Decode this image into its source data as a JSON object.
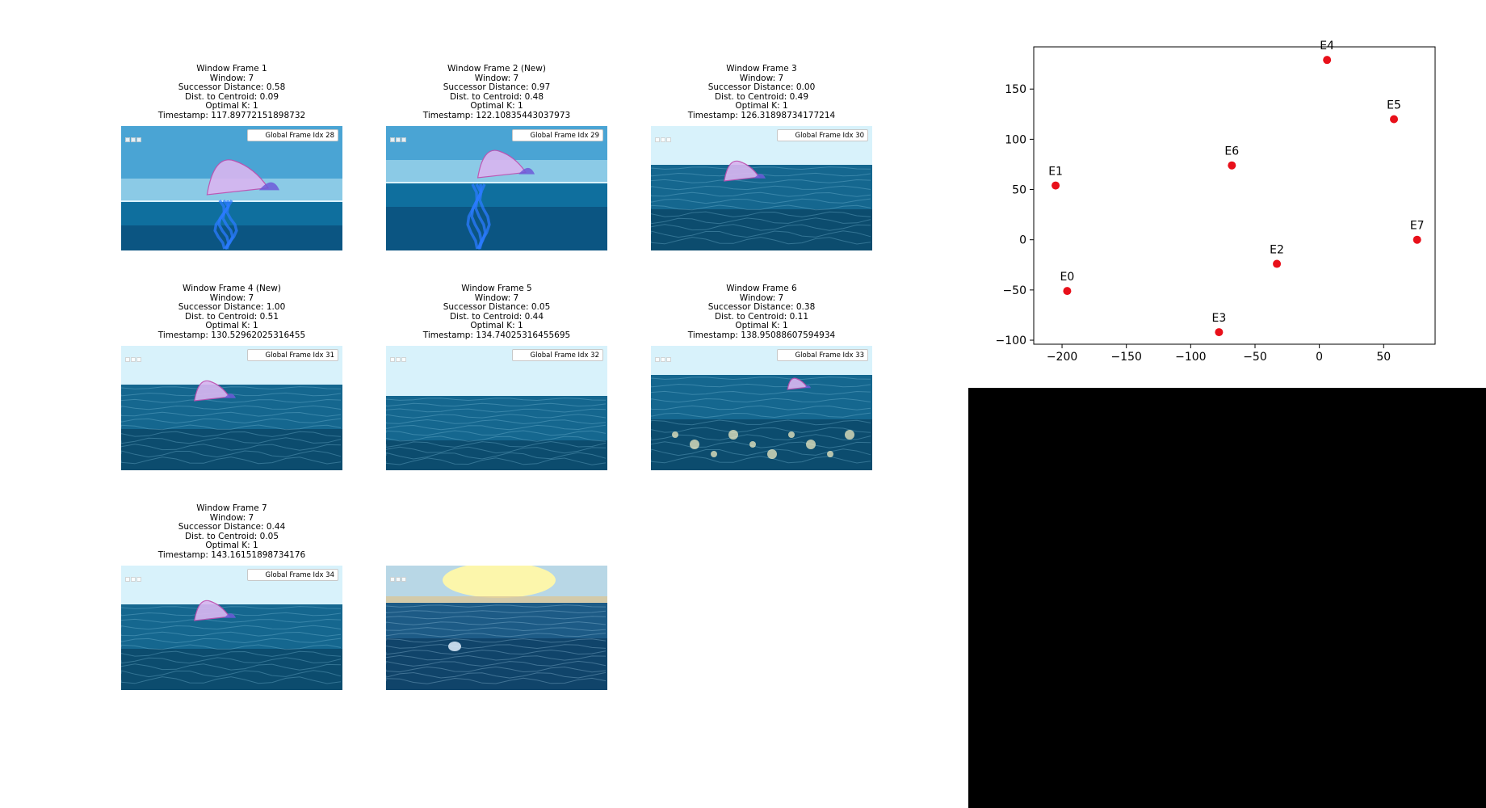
{
  "frames": [
    {
      "title": "Window Frame 1",
      "window": "Window: 7",
      "successor": "Successor Distance: 0.58",
      "centroid": "Dist. to Centroid: 0.09",
      "optimal_k": "Optimal K: 1",
      "timestamp": "Timestamp: 117.89772151898732",
      "idx_label": "Global Frame Idx 28",
      "scene": "jelly-large"
    },
    {
      "title": "Window Frame 2 (New)",
      "window": "Window: 7",
      "successor": "Successor Distance: 0.97",
      "centroid": "Dist. to Centroid: 0.48",
      "optimal_k": "Optimal K: 1",
      "timestamp": "Timestamp: 122.10835443037973",
      "idx_label": "Global Frame Idx 29",
      "scene": "jelly-split"
    },
    {
      "title": "Window Frame 3",
      "window": "Window: 7",
      "successor": "Successor Distance: 0.00",
      "centroid": "Dist. to Centroid: 0.49",
      "optimal_k": "Optimal K: 1",
      "timestamp": "Timestamp: 126.31898734177214",
      "idx_label": "Global Frame Idx 30",
      "scene": "waves-jelly"
    },
    {
      "title": "Window Frame 4 (New)",
      "window": "Window: 7",
      "successor": "Successor Distance: 1.00",
      "centroid": "Dist. to Centroid: 0.51",
      "optimal_k": "Optimal K: 1",
      "timestamp": "Timestamp: 130.52962025316455",
      "idx_label": "Global Frame Idx 31",
      "scene": "waves-jelly"
    },
    {
      "title": "Window Frame 5",
      "window": "Window: 7",
      "successor": "Successor Distance: 0.05",
      "centroid": "Dist. to Centroid: 0.44",
      "optimal_k": "Optimal K: 1",
      "timestamp": "Timestamp: 134.74025316455695",
      "idx_label": "Global Frame Idx 32",
      "scene": "waves"
    },
    {
      "title": "Window Frame 6",
      "window": "Window: 7",
      "successor": "Successor Distance: 0.38",
      "centroid": "Dist. to Centroid: 0.11",
      "optimal_k": "Optimal K: 1",
      "timestamp": "Timestamp: 138.95088607594934",
      "idx_label": "Global Frame Idx 33",
      "scene": "waves-sparkle"
    },
    {
      "title": "Window Frame 7",
      "window": "Window: 7",
      "successor": "Successor Distance: 0.44",
      "centroid": "Dist. to Centroid: 0.05",
      "optimal_k": "Optimal K: 1",
      "timestamp": "Timestamp: 143.16151898734176",
      "idx_label": "Global Frame Idx 34",
      "scene": "waves-jelly"
    },
    {
      "title": "",
      "window": "",
      "successor": "",
      "centroid": "",
      "optimal_k": "",
      "timestamp": "",
      "idx_label": "",
      "scene": "sunset"
    }
  ],
  "colors": {
    "point": "#e8101a",
    "sky": "#bfe8f6",
    "sea": "#0d5f86",
    "sea_dark": "#083d5c",
    "black_panel": "#000000"
  },
  "chart_data": {
    "type": "scatter",
    "title": "",
    "xlabel": "",
    "ylabel": "",
    "xlim": [
      -222,
      90
    ],
    "ylim": [
      -104,
      192
    ],
    "xticks": [
      -200,
      -150,
      -100,
      -50,
      0,
      50
    ],
    "yticks": [
      -100,
      -50,
      0,
      50,
      100,
      150
    ],
    "xtick_labels": [
      "−200",
      "−150",
      "−100",
      "−50",
      "0",
      "50"
    ],
    "ytick_labels": [
      "−100",
      "−50",
      "0",
      "50",
      "100",
      "150"
    ],
    "grid": false,
    "points": [
      {
        "label": "E0",
        "x": -196,
        "y": -51
      },
      {
        "label": "E1",
        "x": -205,
        "y": 54
      },
      {
        "label": "E2",
        "x": -33,
        "y": -24
      },
      {
        "label": "E3",
        "x": -78,
        "y": -92
      },
      {
        "label": "E4",
        "x": 6,
        "y": 179
      },
      {
        "label": "E5",
        "x": 58,
        "y": 120
      },
      {
        "label": "E6",
        "x": -68,
        "y": 74
      },
      {
        "label": "E7",
        "x": 76,
        "y": 0
      }
    ]
  }
}
